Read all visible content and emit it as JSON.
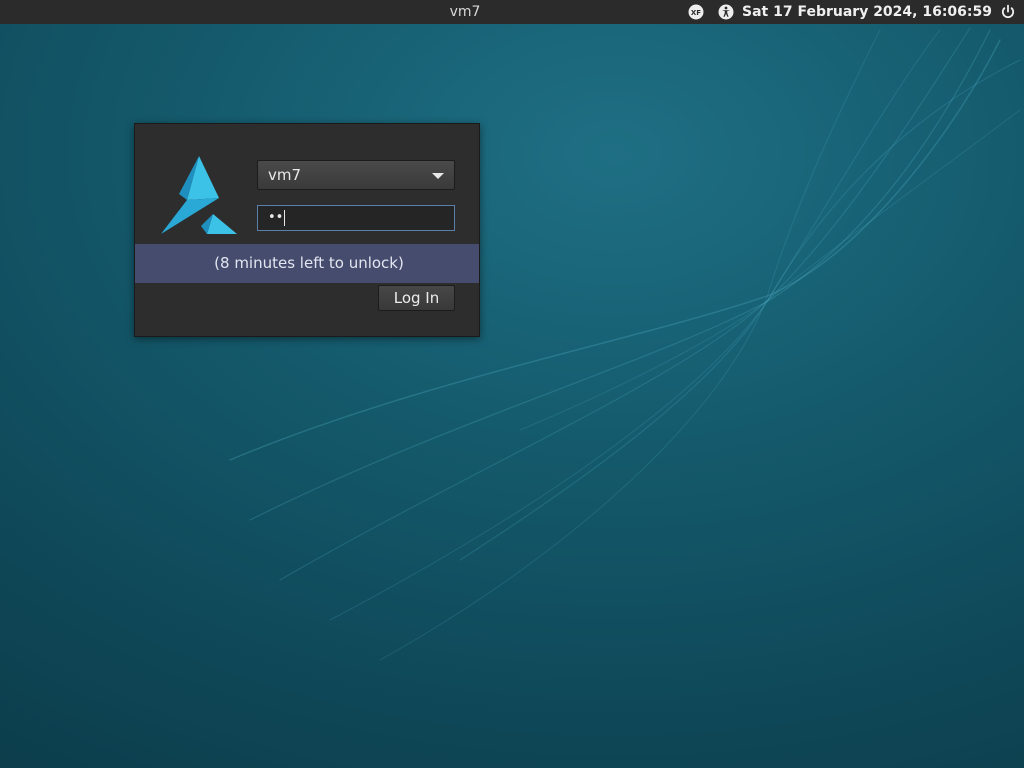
{
  "top_panel": {
    "hostname": "vm7",
    "clock": "Sat 17 February 2024, 16:06:59",
    "icons": {
      "keyboard_layout": "xfce-logo-icon",
      "accessibility": "accessibility-icon",
      "power": "power-icon"
    }
  },
  "login": {
    "user_selected": "vm7",
    "password_value": "••",
    "message": "(8 minutes left to unlock)",
    "login_button_label": "Log In",
    "logo_icon": "distro-logo-icon"
  },
  "colors": {
    "panel": "#2b2b2b",
    "window": "#2d2d2d",
    "message_bar": "#454c6e",
    "logo_accent": "#2aa8d6",
    "focus_border": "#5b7fa8"
  }
}
